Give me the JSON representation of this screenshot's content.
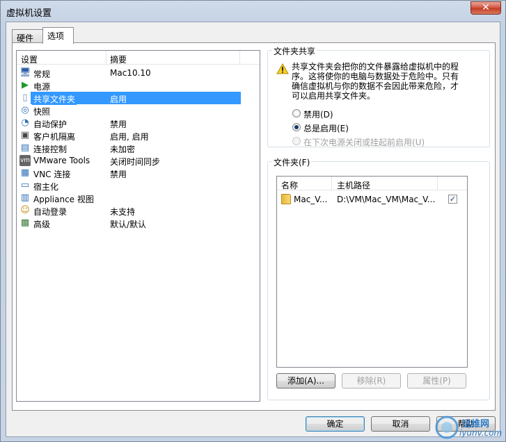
{
  "window": {
    "title": "虚拟机设置",
    "close_glyph": "✕"
  },
  "tabs": [
    {
      "label": "硬件",
      "active": false
    },
    {
      "label": "选项",
      "active": true
    }
  ],
  "settings": {
    "columns": {
      "setting": "设置",
      "summary": "摘要"
    },
    "items": [
      {
        "icon": "monitor-icon",
        "glyph": "🖥",
        "label": "常规",
        "value": "Mac10.10"
      },
      {
        "icon": "power-play-icon",
        "glyph": "▶",
        "label": "电源",
        "value": ""
      },
      {
        "icon": "shared-folder-icon",
        "glyph": "▯",
        "label": "共享文件夹",
        "value": "启用",
        "selected": true
      },
      {
        "icon": "snapshot-icon",
        "glyph": "◎",
        "label": "快照",
        "value": ""
      },
      {
        "icon": "autoprotect-icon",
        "glyph": "◔",
        "label": "自动保护",
        "value": "禁用"
      },
      {
        "icon": "guest-isolation-icon",
        "glyph": "▣",
        "label": "客户机隔离",
        "value": "启用, 启用"
      },
      {
        "icon": "access-control-icon",
        "glyph": "▤",
        "label": "连接控制",
        "value": "未加密"
      },
      {
        "icon": "vmware-tools-icon",
        "glyph": "vm",
        "label": "VMware Tools",
        "value": "关闭时间同步"
      },
      {
        "icon": "vnc-icon",
        "glyph": "▦",
        "label": "VNC 连接",
        "value": "禁用"
      },
      {
        "icon": "unity-icon",
        "glyph": "▭",
        "label": "宿主化",
        "value": ""
      },
      {
        "icon": "appliance-icon",
        "glyph": "▥",
        "label": "Appliance 视图",
        "value": ""
      },
      {
        "icon": "autologin-icon",
        "glyph": "☺",
        "label": "自动登录",
        "value": "未支持"
      },
      {
        "icon": "advanced-icon",
        "glyph": "▩",
        "label": "高级",
        "value": "默认/默认"
      }
    ]
  },
  "folder_sharing": {
    "title": "文件夹共享",
    "warning": "共享文件夹会把你的文件暴露给虚拟机中的程序。这将使你的电脑与数据处于危险中。只有确信虚拟机与你的数据不会因此带来危险，才可以启用共享文件夹。",
    "options": [
      {
        "label": "禁用(D)",
        "checked": false,
        "disabled": false
      },
      {
        "label": "总是启用(E)",
        "checked": true,
        "disabled": false
      },
      {
        "label": "在下次电源关闭或挂起前启用(U)",
        "checked": false,
        "disabled": true
      }
    ]
  },
  "folders": {
    "title": "文件夹(F)",
    "columns": {
      "name": "名称",
      "host_path": "主机路径"
    },
    "rows": [
      {
        "name": "Mac_V...",
        "host_path": "D:\\VM\\Mac_VM\\Mac_V...",
        "enabled_mark": "✓"
      }
    ],
    "buttons": {
      "add": "添加(A)...",
      "remove": "移除(R)",
      "properties": "属性(P)"
    }
  },
  "footer": {
    "ok": "确定",
    "cancel": "取消",
    "help": "帮助"
  },
  "watermark": {
    "cn": "运维网",
    "url": "iyunv.com"
  }
}
